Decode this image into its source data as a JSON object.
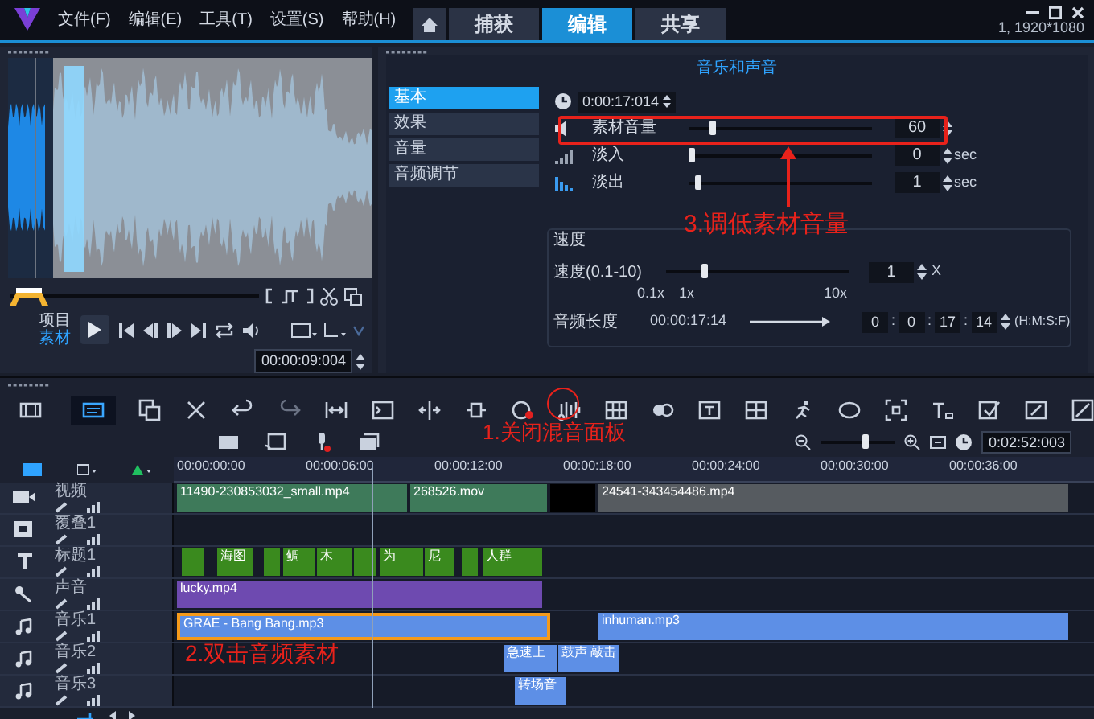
{
  "menu": [
    "文件(F)",
    "编辑(E)",
    "工具(T)",
    "设置(S)",
    "帮助(H)"
  ],
  "tabs": [
    {
      "label": "捕获",
      "selected": false
    },
    {
      "label": "编辑",
      "selected": true
    },
    {
      "label": "共享",
      "selected": false
    }
  ],
  "resolution": "1, 1920*1080",
  "preview": {
    "modes": [
      {
        "label": "项目",
        "selected": false
      },
      {
        "label": "素材",
        "selected": true
      }
    ],
    "timecode": "00:00:09:004"
  },
  "options_panel": {
    "title": "音乐和声音",
    "side_tabs": [
      {
        "label": "基本",
        "selected": true
      },
      {
        "label": "效果",
        "selected": false
      },
      {
        "label": "音量",
        "selected": false
      },
      {
        "label": "音频调节",
        "selected": false
      }
    ],
    "duration": "0:00:17:014",
    "controls": [
      {
        "kind": "volume",
        "label": "素材音量",
        "level": 0.12,
        "value": "60"
      },
      {
        "kind": "fade-in",
        "label": "淡入",
        "level": 0,
        "value": "0",
        "unit": "sec"
      },
      {
        "kind": "fade-out",
        "label": "淡出",
        "level": 0.04,
        "value": "1",
        "unit": "sec"
      }
    ],
    "speed": {
      "title": "速度",
      "label": "速度(0.1-10)",
      "level": 0.2,
      "value": "1",
      "unit": "X",
      "ticks": [
        "0.1x",
        "1x",
        "10x"
      ],
      "length_label": "音频长度",
      "length": "00:00:17:14",
      "length_fields": [
        "0",
        "0",
        "17",
        "14"
      ],
      "length_separators": [
        ":",
        ":",
        ":"
      ],
      "length_format": "(H:M:S:F)"
    }
  },
  "zoom": {
    "level": 0.6
  },
  "zoom_timecode": "0:02:52:003",
  "ruler": [
    "00:00:00:00",
    "00:00:06:00",
    "00:00:12:00",
    "00:00:18:00",
    "00:00:24:00",
    "00:00:30:00",
    "00:00:36:00"
  ],
  "tracks": [
    {
      "name": "视频",
      "kind": "video",
      "clips": [
        {
          "kind": "video",
          "label": "11490-230853032_small.mp4",
          "selected": false
        },
        {
          "kind": "video",
          "label": "268526.mov",
          "selected": false
        },
        {
          "kind": "blank",
          "selected": false
        },
        {
          "kind": "video-grey",
          "label": "24541-343454486.mp4",
          "selected": false
        }
      ]
    },
    {
      "name": "覆叠1",
      "kind": "overlay"
    },
    {
      "name": "标题1",
      "kind": "title",
      "clips": [
        {
          "kind": "title",
          "selected": false
        },
        {
          "kind": "title",
          "label": "海图",
          "selected": false
        },
        {
          "kind": "title",
          "selected": false
        },
        {
          "kind": "title",
          "label": "鲷",
          "selected": false
        },
        {
          "kind": "title",
          "label": "木",
          "selected": false
        },
        {
          "kind": "title",
          "selected": false
        },
        {
          "kind": "title",
          "label": "为",
          "selected": false
        },
        {
          "kind": "title",
          "label": "尼",
          "selected": false
        },
        {
          "kind": "title",
          "selected": false
        },
        {
          "kind": "title",
          "label": "人群",
          "selected": false
        }
      ]
    },
    {
      "name": "声音",
      "kind": "voice",
      "clips": [
        {
          "kind": "voice",
          "label": "lucky.mp4",
          "selected": false
        }
      ]
    },
    {
      "name": "音乐1",
      "kind": "music",
      "clips": [
        {
          "kind": "music",
          "label": "GRAE - Bang Bang.mp3",
          "selected": true
        },
        {
          "kind": "music",
          "label": "inhuman.mp3",
          "selected": false
        }
      ]
    },
    {
      "name": "音乐2",
      "kind": "music",
      "clips": [
        {
          "kind": "music",
          "label": "急速上",
          "selected": false
        },
        {
          "kind": "music",
          "label": "鼓声 敲击",
          "selected": false
        }
      ]
    },
    {
      "name": "音乐3",
      "kind": "music",
      "clips": [
        {
          "kind": "music",
          "label": "转场音",
          "selected": false
        }
      ]
    }
  ],
  "annotations": [
    "1.关闭混音面板",
    "2.双击音频素材",
    "3.调低素材音量"
  ]
}
